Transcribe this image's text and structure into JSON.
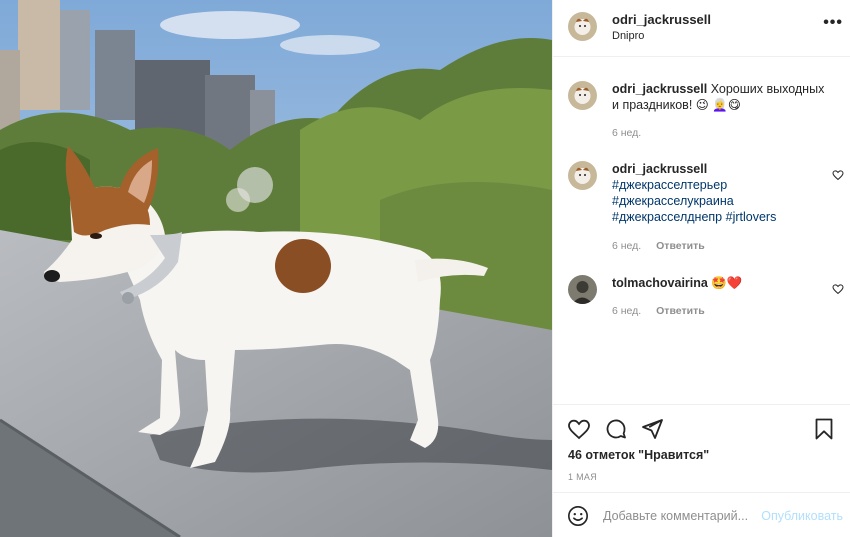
{
  "header": {
    "username": "odri_jackrussell",
    "location": "Dnipro",
    "more": "•••"
  },
  "caption": {
    "username": "odri_jackrussell",
    "text": "Хороших выходных и праздников! 😉 👩‍🦳😋",
    "time": "6 нед."
  },
  "comments": [
    {
      "username": "odri_jackrussell",
      "tags": [
        "#джекрасселтерьер",
        "#джекрасселукраина",
        "#джекрасселднепр",
        "#jrtlovers"
      ],
      "time": "6 нед.",
      "reply": "Ответить"
    },
    {
      "username": "tolmachovairina",
      "text": "🤩❤️",
      "time": "6 нед.",
      "reply": "Ответить"
    }
  ],
  "actions": {
    "likes": "46 отметок \"Нравится\"",
    "date": "1 МАЯ"
  },
  "add_comment": {
    "placeholder": "Добавьте комментарий...",
    "publish": "Опубликовать"
  },
  "icons": [
    "more-icon",
    "heart-icon",
    "comment-icon",
    "share-icon",
    "bookmark-icon",
    "smile-icon",
    "small-heart-icon"
  ],
  "colors": {
    "text": "#262626",
    "secondary": "#8e8e8e",
    "hashtag": "#00376b",
    "publish_disabled": "#b2dffc",
    "border": "#efefef"
  }
}
